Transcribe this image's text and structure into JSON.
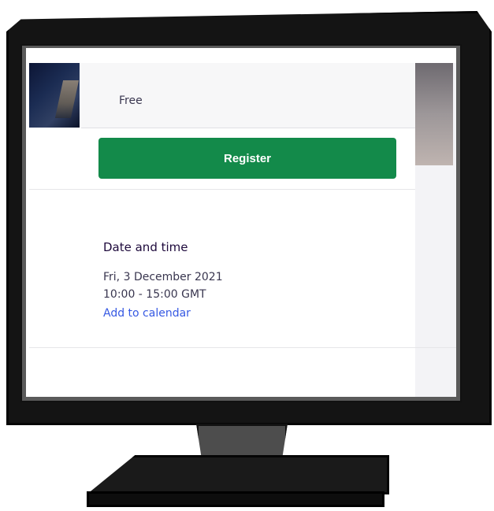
{
  "ticket": {
    "price": "Free",
    "register_label": "Register"
  },
  "date_time": {
    "title": "Date and time",
    "date": "Fri, 3 December 2021",
    "time": "10:00 - 15:00 GMT",
    "add_to_calendar": "Add to calendar"
  },
  "colors": {
    "register_green": "#138a4a",
    "link_blue": "#3659e3",
    "monitor_black": "#141414"
  }
}
